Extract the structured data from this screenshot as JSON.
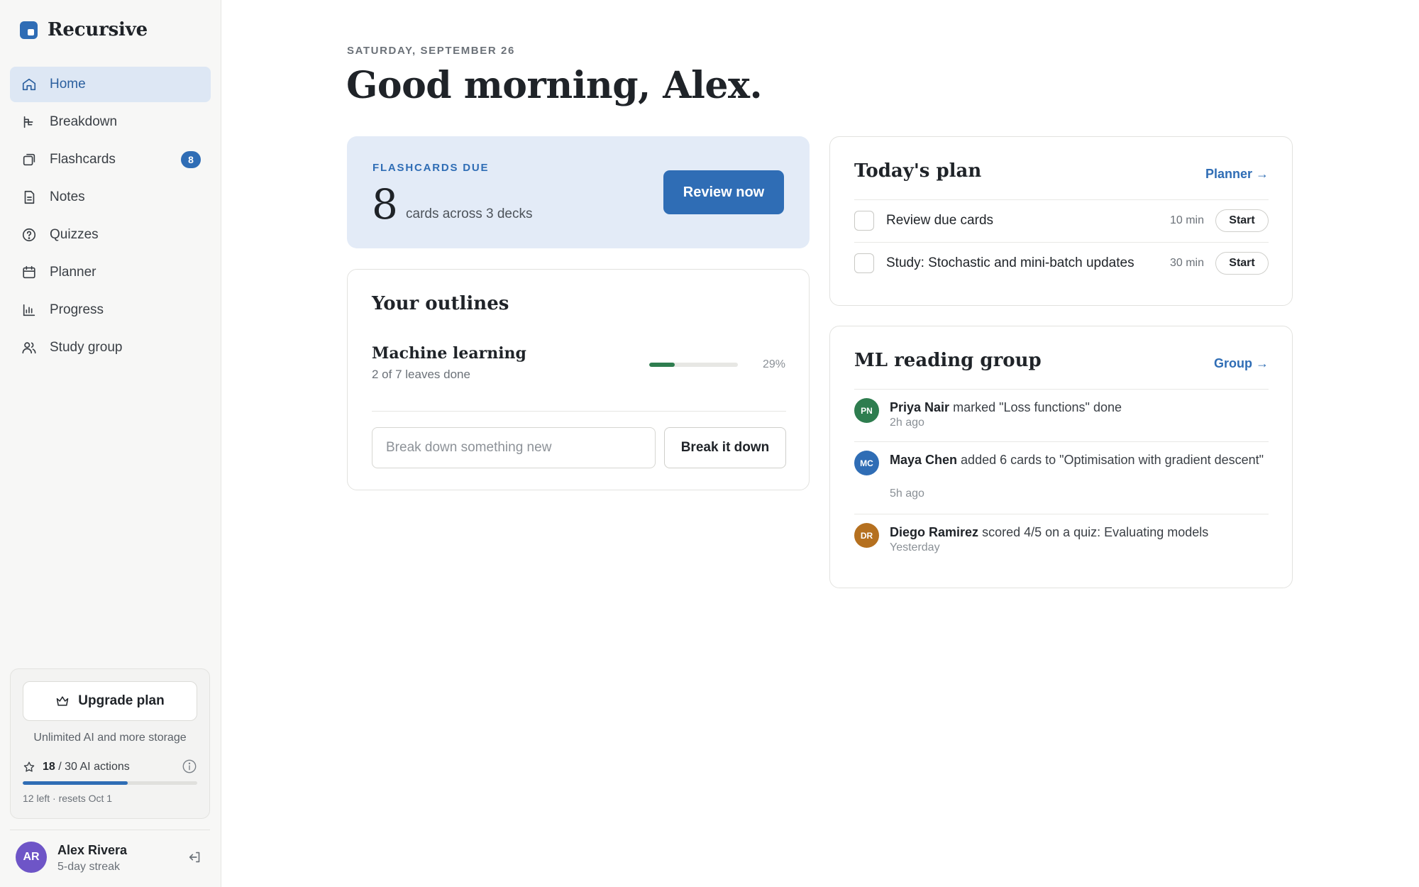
{
  "app": {
    "name": "Recursive"
  },
  "sidebar": {
    "items": [
      {
        "label": "Home",
        "icon": "home-icon",
        "active": true
      },
      {
        "label": "Breakdown",
        "icon": "breakdown-icon"
      },
      {
        "label": "Flashcards",
        "icon": "flashcards-icon",
        "badge": "8"
      },
      {
        "label": "Notes",
        "icon": "notes-icon"
      },
      {
        "label": "Quizzes",
        "icon": "quizzes-icon"
      },
      {
        "label": "Planner",
        "icon": "calendar-icon"
      },
      {
        "label": "Progress",
        "icon": "bar-chart-icon"
      },
      {
        "label": "Study group",
        "icon": "users-icon"
      }
    ],
    "upgrade": {
      "button_label": "Upgrade plan",
      "subtitle": "Unlimited AI and more storage",
      "usage_used": "18",
      "usage_rest": "/ 30 AI actions",
      "usage_fraction": 0.6,
      "note": "12 left · resets Oct 1"
    },
    "user": {
      "initials": "AR",
      "name": "Alex Rivera",
      "streak": "5-day streak"
    }
  },
  "main": {
    "date": "SATURDAY, SEPTEMBER 26",
    "greeting": "Good morning, Alex.",
    "flashcards_due": {
      "label": "FLASHCARDS DUE",
      "count": "8",
      "subtitle": "cards across 3 decks",
      "button": "Review now"
    },
    "outlines": {
      "title": "Your outlines",
      "items": [
        {
          "name": "Machine learning",
          "progress_text": "2 of 7 leaves done",
          "percent_label": "29%",
          "percent": 0.29
        }
      ],
      "input_placeholder": "Break down something new",
      "button": "Break it down"
    },
    "plan": {
      "title": "Today's plan",
      "link": "Planner →",
      "tasks": [
        {
          "label": "Review due cards",
          "time": "10 min",
          "button": "Start"
        },
        {
          "label": "Study: Stochastic and mini-batch updates",
          "time": "30 min",
          "button": "Start"
        }
      ]
    },
    "group": {
      "title": "ML reading group",
      "link": "Group →",
      "activity": [
        {
          "initials": "PN",
          "name": "Priya Nair",
          "text": "marked \"Loss functions\" done",
          "time": "2h ago",
          "color": "#2e7d4f"
        },
        {
          "initials": "MC",
          "name": "Maya Chen",
          "text": "added 6 cards to \"Optimisation with gradient descent\"",
          "time": "5h ago",
          "color": "#2f6db5"
        },
        {
          "initials": "DR",
          "name": "Diego Ramirez",
          "text": "scored 4/5 on a quiz: Evaluating models",
          "time": "Yesterday",
          "color": "#b5701f"
        }
      ]
    }
  },
  "colors": {
    "accent": "#2f6db5",
    "accent_light": "#e3ebf7",
    "success": "#2e7d4f",
    "user_avatar": "#6e55c7"
  }
}
